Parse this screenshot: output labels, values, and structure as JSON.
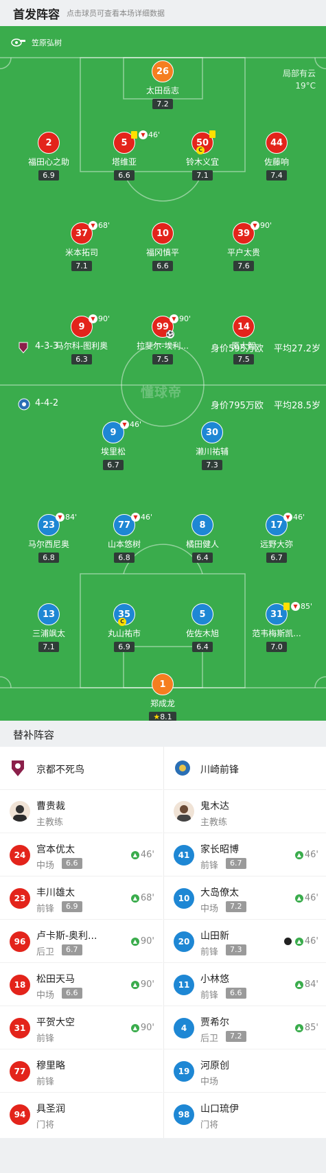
{
  "header": {
    "title": "首发阵容",
    "subtitle": "点击球员可查看本场详细数据"
  },
  "pitch": {
    "referee": "笠原弘树",
    "weather": "局部有云",
    "temperature": "19°C",
    "watermark": "懂球帝",
    "home_info": {
      "formation": "4-3-3",
      "value": "身价595万欧",
      "age": "平均27.2岁"
    },
    "away_info": {
      "formation": "4-4-2",
      "value": "身价795万欧",
      "age": "平均28.5岁"
    },
    "home_players": [
      {
        "num": "26",
        "name": "太田岳志",
        "rating": "7.2"
      },
      {
        "num": "2",
        "name": "福田心之助",
        "rating": "6.9"
      },
      {
        "num": "5",
        "name": "塔维亚",
        "rating": "6.6",
        "event": "46'"
      },
      {
        "num": "50",
        "name": "铃木义宜",
        "rating": "7.1"
      },
      {
        "num": "44",
        "name": "佐藤响",
        "rating": "7.4"
      },
      {
        "num": "37",
        "name": "米本拓司",
        "rating": "7.1",
        "event": "68'"
      },
      {
        "num": "10",
        "name": "福冈慎平",
        "rating": "6.6"
      },
      {
        "num": "39",
        "name": "平户太贵",
        "rating": "7.6",
        "event": "90'"
      },
      {
        "num": "9",
        "name": "马尔科-图利奥",
        "rating": "6.3",
        "event": "90'"
      },
      {
        "num": "99",
        "name": "拉斐尔-埃利...",
        "rating": "7.5",
        "event": "90'"
      },
      {
        "num": "14",
        "name": "原大智",
        "rating": "7.5"
      }
    ],
    "away_players": [
      {
        "num": "9",
        "name": "埃里松",
        "rating": "6.7",
        "event": "46'"
      },
      {
        "num": "30",
        "name": "濑川祐辅",
        "rating": "7.3"
      },
      {
        "num": "23",
        "name": "马尔西尼奥",
        "rating": "6.8",
        "event": "84'"
      },
      {
        "num": "77",
        "name": "山本悠树",
        "rating": "6.8",
        "event": "46'"
      },
      {
        "num": "8",
        "name": "橘田健人",
        "rating": "6.4"
      },
      {
        "num": "17",
        "name": "远野大弥",
        "rating": "6.7",
        "event": "46'"
      },
      {
        "num": "13",
        "name": "三浦飒太",
        "rating": "7.1"
      },
      {
        "num": "35",
        "name": "丸山祐市",
        "rating": "6.9"
      },
      {
        "num": "5",
        "name": "佐佐木旭",
        "rating": "6.4"
      },
      {
        "num": "31",
        "name": "范韦梅斯凯...",
        "rating": "7.0",
        "event": "85'"
      },
      {
        "num": "1",
        "name": "郑成龙",
        "rating": "8.1"
      }
    ]
  },
  "subs": {
    "title": "替补阵容",
    "home_team": "京都不死鸟",
    "away_team": "川崎前锋",
    "home_coach": {
      "name": "曹贵裁",
      "role": "主教练"
    },
    "away_coach": {
      "name": "鬼木达",
      "role": "主教练"
    },
    "home": [
      {
        "num": "24",
        "name": "宫本优太",
        "pos": "中场",
        "rating": "6.6",
        "in": "46'"
      },
      {
        "num": "23",
        "name": "丰川雄太",
        "pos": "前锋",
        "rating": "6.9",
        "in": "68'"
      },
      {
        "num": "96",
        "name": "卢卡斯-奥利...",
        "pos": "后卫",
        "rating": "6.7",
        "in": "90'"
      },
      {
        "num": "18",
        "name": "松田天马",
        "pos": "中场",
        "rating": "6.6",
        "in": "90'"
      },
      {
        "num": "31",
        "name": "平贺大空",
        "pos": "前锋",
        "in": "90'"
      },
      {
        "num": "77",
        "name": "穆里略",
        "pos": "前锋"
      },
      {
        "num": "94",
        "name": "具圣润",
        "pos": "门将"
      }
    ],
    "away": [
      {
        "num": "41",
        "name": "家长昭博",
        "pos": "前锋",
        "rating": "6.7",
        "in": "46'"
      },
      {
        "num": "10",
        "name": "大岛僚太",
        "pos": "中场",
        "rating": "7.2",
        "in": "46'"
      },
      {
        "num": "20",
        "name": "山田新",
        "pos": "前锋",
        "rating": "7.3",
        "in": "46'"
      },
      {
        "num": "11",
        "name": "小林悠",
        "pos": "前锋",
        "rating": "6.6",
        "in": "84'"
      },
      {
        "num": "4",
        "name": "贾希尔",
        "pos": "后卫",
        "rating": "7.2",
        "in": "85'"
      },
      {
        "num": "19",
        "name": "河原创",
        "pos": "中场"
      },
      {
        "num": "98",
        "name": "山口琉伊",
        "pos": "门将"
      }
    ]
  },
  "colors": {
    "pitch": "#3aac4c",
    "home": "#e3241b",
    "away": "#1e87d4",
    "keeper": "#f57e20"
  }
}
